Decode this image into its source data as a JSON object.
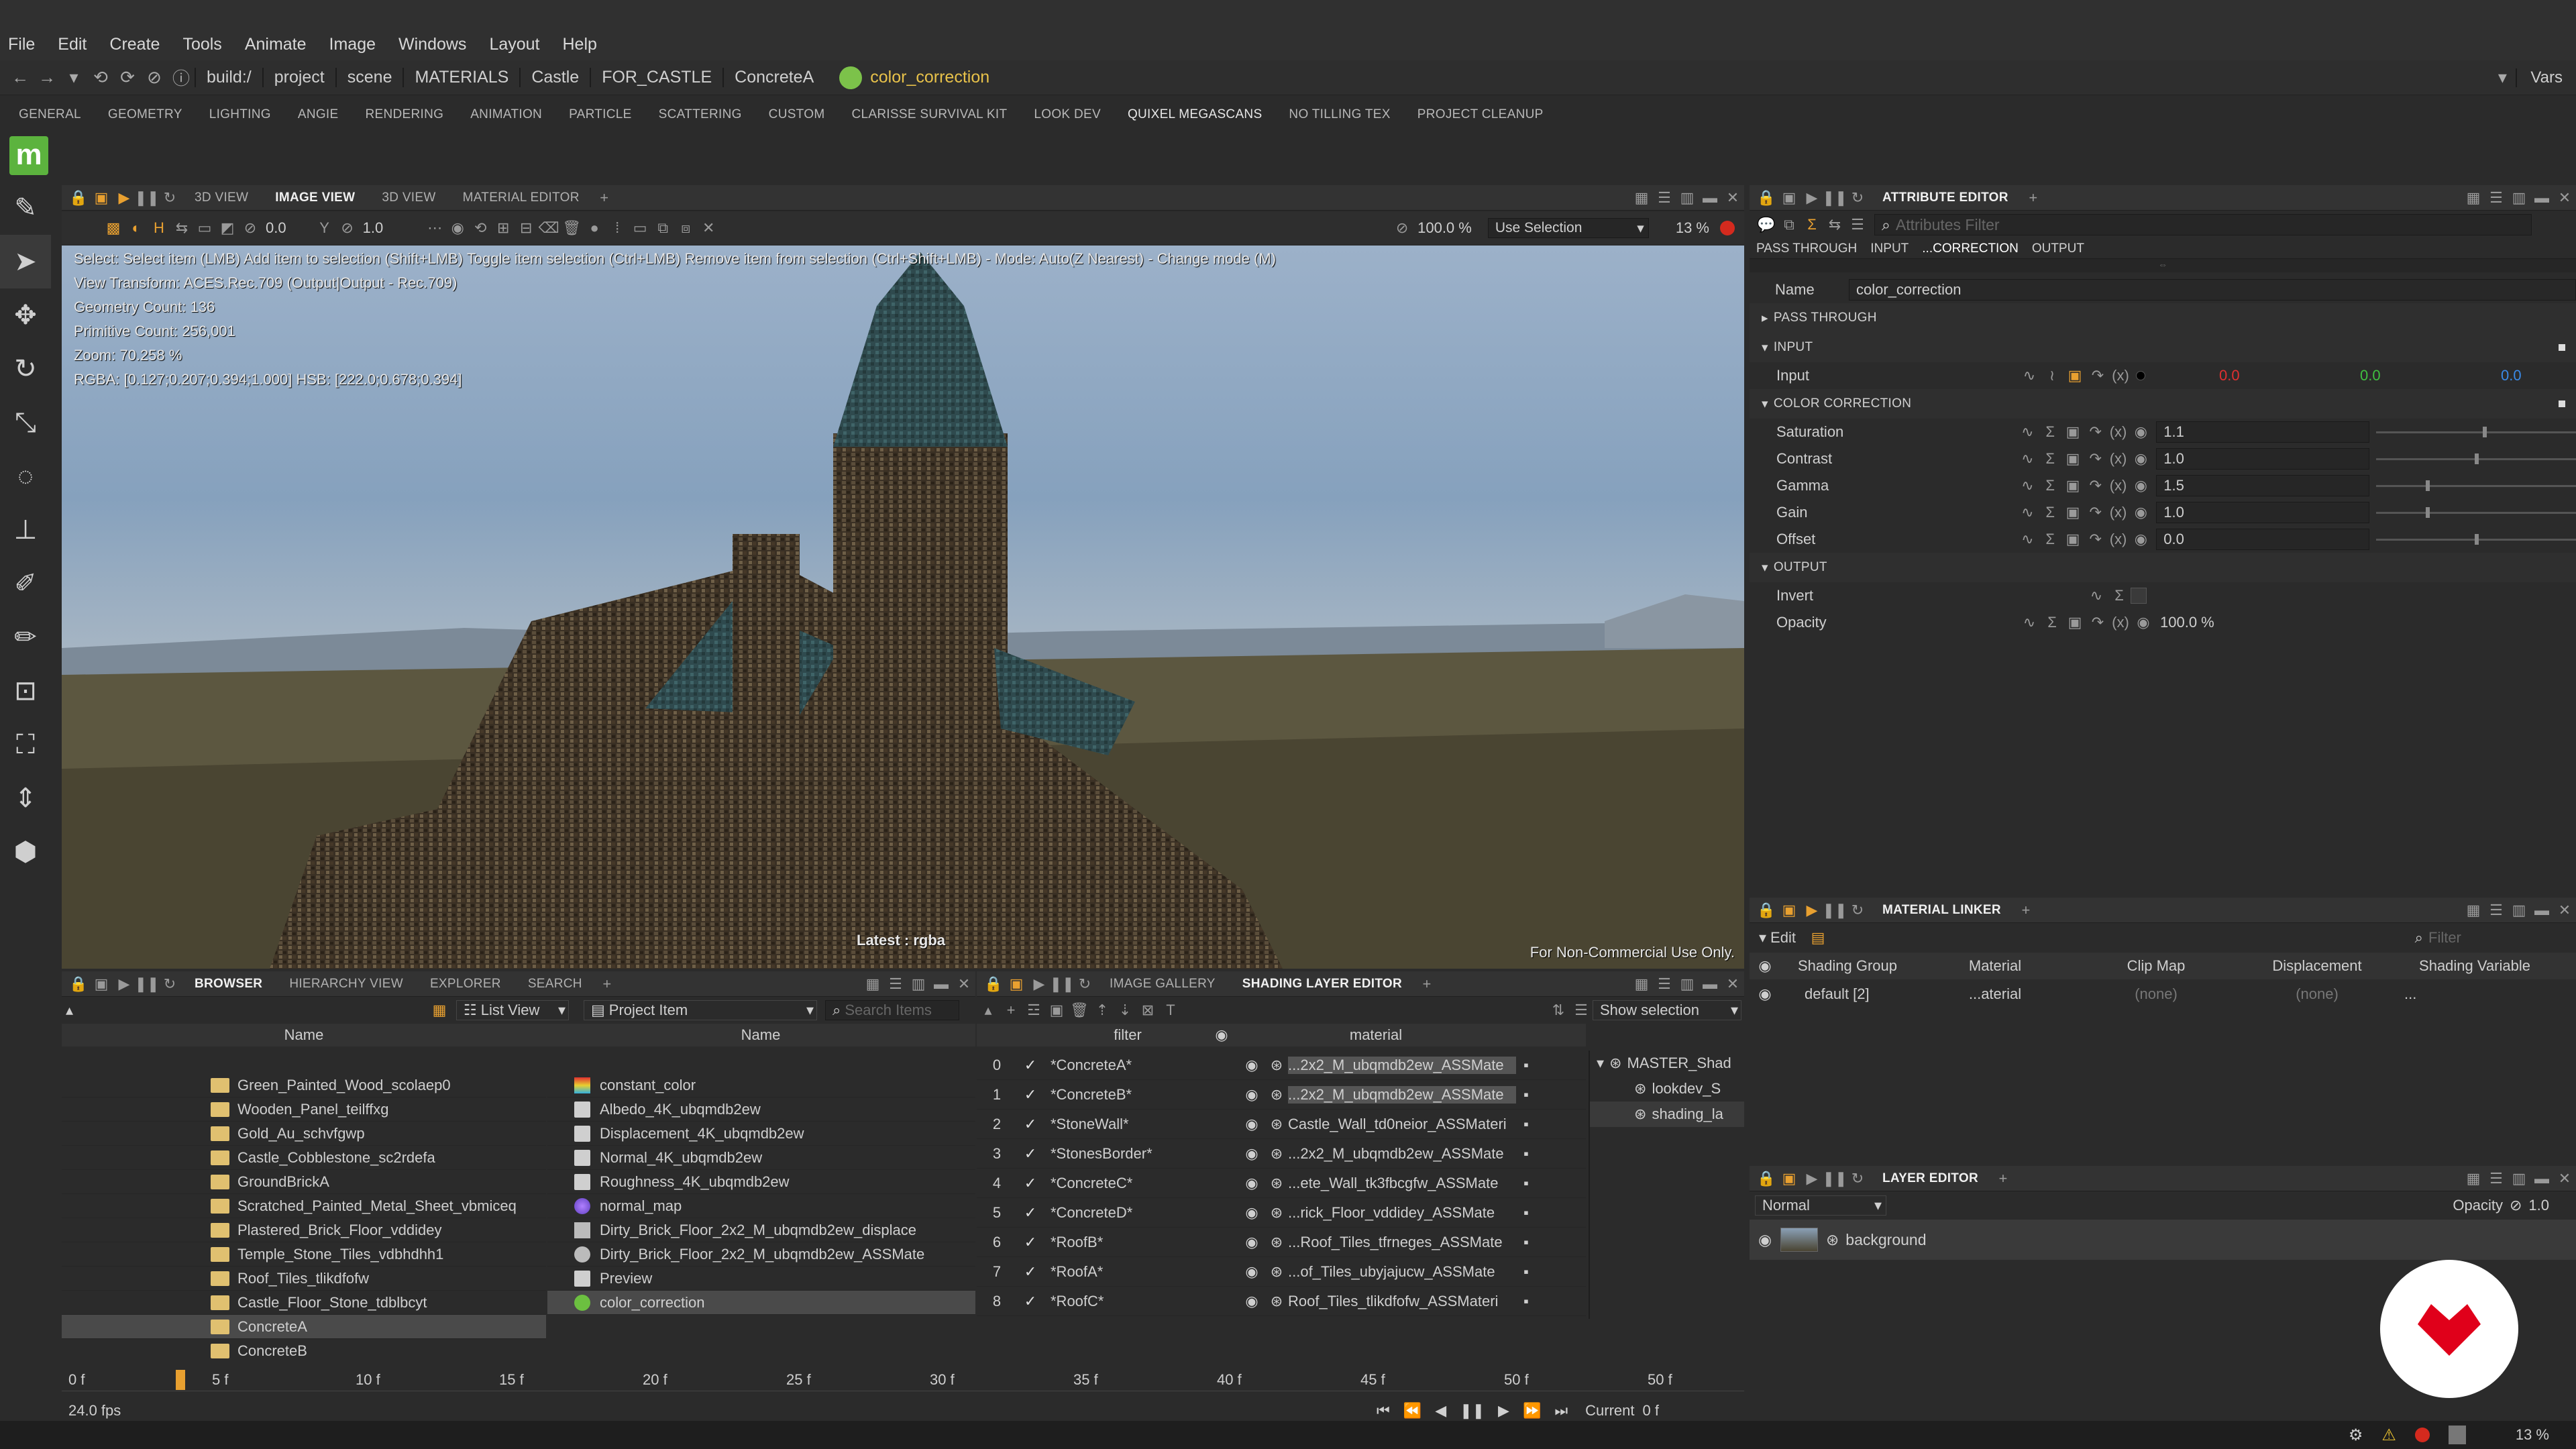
{
  "menu": [
    "File",
    "Edit",
    "Create",
    "Tools",
    "Animate",
    "Image",
    "Windows",
    "Layout",
    "Help"
  ],
  "path": {
    "items": [
      "build:/",
      "project",
      "scene",
      "MATERIALS",
      "Castle",
      "FOR_CASTLE",
      "ConcreteA"
    ],
    "active": "color_correction",
    "vars": "Vars"
  },
  "shelf": [
    "GENERAL",
    "GEOMETRY",
    "LIGHTING",
    "ANGIE",
    "RENDERING",
    "ANIMATION",
    "PARTICLE",
    "SCATTERING",
    "CUSTOM",
    "CLARISSE SURVIVAL KIT",
    "LOOK DEV",
    "QUIXEL MEGASCANS",
    "NO TILLING TEX",
    "PROJECT CLEANUP"
  ],
  "logo": "m",
  "viewport": {
    "tabs": [
      "3D VIEW",
      "IMAGE VIEW",
      "3D VIEW",
      "MATERIAL EDITOR"
    ],
    "toolbar": {
      "exposure": "0.0",
      "gamma": "1.0",
      "zoom": "100.0 %",
      "selection": "Use Selection",
      "res": "13 %"
    },
    "info": [
      "Select: Select item (LMB)  Add item to selection (Shift+LMB)  Toggle item selection (Ctrl+LMB)  Remove item from selection (Ctrl+Shift+LMB)  - Mode: Auto(Z Nearest) - Change mode (M)",
      "View Transform: ACES.Rec.709 (Output|Output - Rec.709)",
      "Geometry Count: 136",
      "Primitive Count: 256,001",
      "Zoom: 70.258 %",
      "RGBA: [0.127;0.207;0.394;1.000] HSB: [222.0;0.678;0.394]"
    ],
    "latest": "Latest : rgba",
    "watermark": "For Non-Commercial Use Only."
  },
  "attr": {
    "tab": "ATTRIBUTE EDITOR",
    "filter": "Attributes Filter",
    "subtabs": [
      "PASS THROUGH",
      "INPUT",
      "...CORRECTION",
      "OUTPUT"
    ],
    "name_label": "Name",
    "name_value": "color_correction",
    "sections": {
      "pass": "PASS THROUGH",
      "input": "INPUT",
      "cc": "COLOR CORRECTION",
      "output": "OUTPUT"
    },
    "input": {
      "label": "Input",
      "r": "0.0",
      "g": "0.0",
      "b": "0.0"
    },
    "cc": [
      {
        "label": "Saturation",
        "value": "1.1",
        "level": 0.54
      },
      {
        "label": "Contrast",
        "value": "1.0",
        "level": 0.5
      },
      {
        "label": "Gamma",
        "value": "1.5",
        "level": 0.25
      },
      {
        "label": "Gain",
        "value": "1.0",
        "level": 0.25
      },
      {
        "label": "Offset",
        "value": "0.0",
        "level": 0.5
      }
    ],
    "invert": "Invert",
    "opacity": {
      "label": "Opacity",
      "value": "100.0 %"
    }
  },
  "linker": {
    "tab": "MATERIAL LINKER",
    "edit": "Edit",
    "filter": "Filter",
    "cols": [
      "Shading Group",
      "Material",
      "Clip Map",
      "Displacement",
      "Shading Variable"
    ],
    "row": {
      "group": "default [2]",
      "material": "...aterial",
      "clip": "(none)",
      "disp": "(none)",
      "var": "..."
    }
  },
  "layer": {
    "tab": "LAYER EDITOR",
    "mode": "Normal",
    "opacity_label": "Opacity",
    "opacity": "1.0",
    "item": "background"
  },
  "browser": {
    "tabs": [
      "BROWSER",
      "HIERARCHY VIEW",
      "EXPLORER",
      "SEARCH"
    ],
    "view": "List View",
    "project": "Project Item",
    "search": "Search Items",
    "col": "Name",
    "folders": [
      "Green_Painted_Wood_scolaep0",
      "Wooden_Panel_teilffxg",
      "Gold_Au_schvfgwp",
      "Castle_Cobblestone_sc2rdefa",
      "GroundBrickA",
      "Scratched_Painted_Metal_Sheet_vbmiceq",
      "Plastered_Brick_Floor_vddidey",
      "Temple_Stone_Tiles_vdbhdhh1",
      "Roof_Tiles_tlikdfofw",
      "Castle_Floor_Stone_tdblbcyt",
      "ConcreteA",
      "ConcreteB"
    ],
    "selected_folder": "ConcreteA",
    "items_col": "Name",
    "items": [
      {
        "n": "constant_color",
        "t": "rgb"
      },
      {
        "n": "Albedo_4K_ubqmdb2ew",
        "t": "tex"
      },
      {
        "n": "Displacement_4K_ubqmdb2ew",
        "t": "tex"
      },
      {
        "n": "Normal_4K_ubqmdb2ew",
        "t": "tex"
      },
      {
        "n": "Roughness_4K_ubqmdb2ew",
        "t": "tex"
      },
      {
        "n": "normal_map",
        "t": "ball"
      },
      {
        "n": "Dirty_Brick_Floor_2x2_M_ubqmdb2ew_displace",
        "t": "tri"
      },
      {
        "n": "Dirty_Brick_Floor_2x2_M_ubqmdb2ew_ASSMate",
        "t": "mat"
      },
      {
        "n": "Preview",
        "t": "tex"
      },
      {
        "n": "color_correction",
        "t": "green"
      }
    ],
    "selected_item": "color_correction"
  },
  "shading": {
    "tabs": [
      "IMAGE GALLERY",
      "SHADING LAYER EDITOR"
    ],
    "show": "Show selection",
    "cols": [
      "filter",
      "material"
    ],
    "rows": [
      {
        "i": "0",
        "f": "*ConcreteA*",
        "m": "...2x2_M_ubqmdb2ew_ASSMate"
      },
      {
        "i": "1",
        "f": "*ConcreteB*",
        "m": "...2x2_M_ubqmdb2ew_ASSMate"
      },
      {
        "i": "2",
        "f": "*StoneWall*",
        "m": "Castle_Wall_td0neior_ASSMateri"
      },
      {
        "i": "3",
        "f": "*StonesBorder*",
        "m": "...2x2_M_ubqmdb2ew_ASSMate"
      },
      {
        "i": "4",
        "f": "*ConcreteC*",
        "m": "...ete_Wall_tk3fbcgfw_ASSMate"
      },
      {
        "i": "5",
        "f": "*ConcreteD*",
        "m": "...rick_Floor_vddidey_ASSMate"
      },
      {
        "i": "6",
        "f": "*RoofB*",
        "m": "...Roof_Tiles_tfrneges_ASSMate"
      },
      {
        "i": "7",
        "f": "*RoofA*",
        "m": "...of_Tiles_ubyjajucw_ASSMate"
      },
      {
        "i": "8",
        "f": "*RoofC*",
        "m": "Roof_Tiles_tlikdfofw_ASSMateri"
      }
    ],
    "tree": [
      "MASTER_Shad",
      "lookdev_S",
      "shading_la"
    ]
  },
  "timeline": {
    "ticks": [
      "0 f",
      "5 f",
      "10 f",
      "15 f",
      "20 f",
      "25 f",
      "30 f",
      "35 f",
      "40 f",
      "45 f",
      "50 f"
    ],
    "end": "50 f",
    "fps": "24.0 fps",
    "current_label": "Current",
    "current": "0 f",
    "start": "0 f"
  },
  "status": {
    "zoom": "13 %"
  },
  "colors": {
    "accent": "#e8a030",
    "logo": "#5cb33e",
    "badge": "#e0001a"
  }
}
